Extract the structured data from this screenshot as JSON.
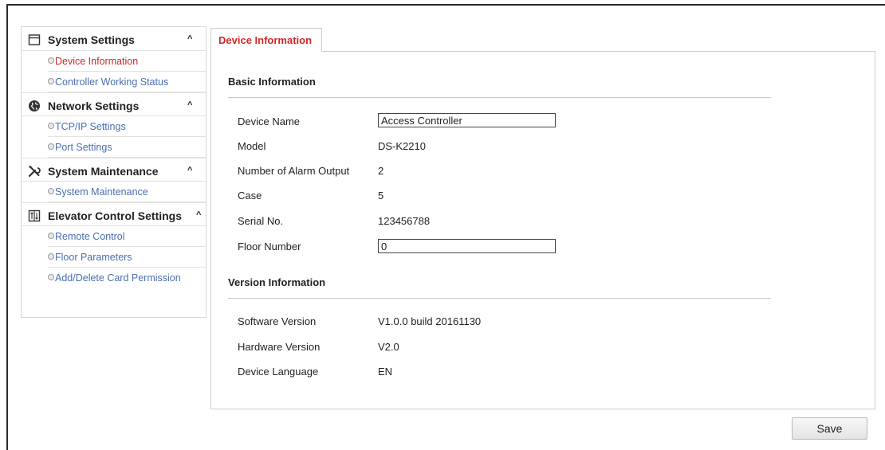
{
  "sidebar": {
    "sections": [
      {
        "title": "System Settings",
        "icon": "window-icon",
        "chevron": "^",
        "items": [
          {
            "label": "Device Information",
            "active": true
          },
          {
            "label": "Controller Working Status",
            "active": false
          }
        ]
      },
      {
        "title": "Network Settings",
        "icon": "globe-icon",
        "chevron": "^",
        "items": [
          {
            "label": "TCP/IP Settings",
            "active": false
          },
          {
            "label": "Port Settings",
            "active": false
          }
        ]
      },
      {
        "title": "System Maintenance",
        "icon": "tools-icon",
        "chevron": "^",
        "items": [
          {
            "label": "System Maintenance",
            "active": false
          }
        ]
      },
      {
        "title": "Elevator Control Settings",
        "icon": "elevator-icon",
        "chevron": "^",
        "items": [
          {
            "label": "Remote Control",
            "active": false
          },
          {
            "label": "Floor Parameters",
            "active": false
          },
          {
            "label": "Add/Delete Card Permission",
            "active": false
          }
        ]
      }
    ]
  },
  "tab": {
    "label": "Device Information"
  },
  "basic": {
    "heading": "Basic Information",
    "device_name": {
      "label": "Device Name",
      "value": "Access Controller"
    },
    "model": {
      "label": "Model",
      "value": "DS-K2210"
    },
    "alarm_output": {
      "label": "Number of Alarm Output",
      "value": "2"
    },
    "case": {
      "label": "Case",
      "value": "5"
    },
    "serial": {
      "label": "Serial No.",
      "value": "123456788"
    },
    "floor_number": {
      "label": "Floor Number",
      "value": "0"
    }
  },
  "version": {
    "heading": "Version Information",
    "software": {
      "label": "Software Version",
      "value": "V1.0.0 build 20161130"
    },
    "hardware": {
      "label": "Hardware Version",
      "value": "V2.0"
    },
    "language": {
      "label": "Device Language",
      "value": "EN"
    }
  },
  "actions": {
    "save_label": "Save"
  },
  "colors": {
    "active_red": "#d02828",
    "link_blue": "#4a6fb0"
  }
}
